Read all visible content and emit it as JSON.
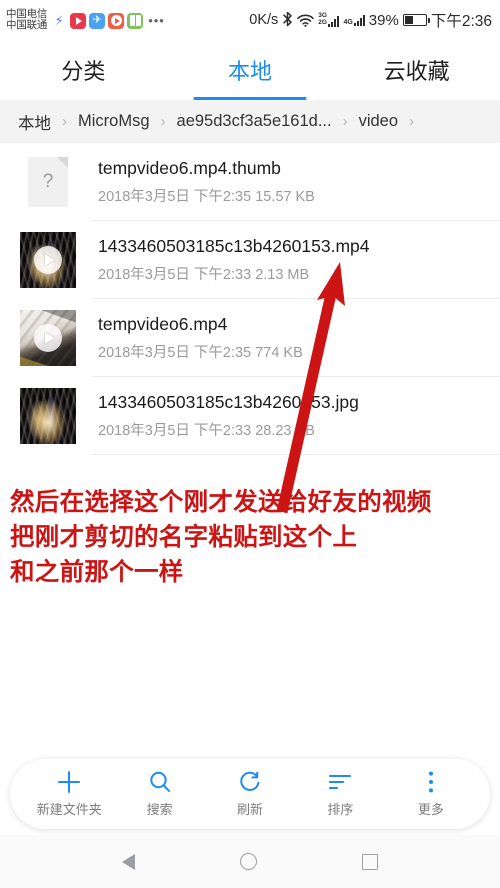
{
  "status_bar": {
    "carrier_line1": "中国电信",
    "carrier_line2": "中国联通",
    "notification_icons": [
      "bolt-icon",
      "video-app-icon",
      "telegram-icon",
      "player-app-icon",
      "notes-app-icon"
    ],
    "overflow_icon": "ellipsis-icon",
    "network_speed": "0K/s",
    "bluetooth_icon": "bluetooth-icon",
    "wifi_icon": "wifi-icon",
    "signal_label_top": "3G",
    "signal_label_bottom": "2G",
    "signal2_label": "4G",
    "battery_percent": "39%",
    "clock": "下午2:36"
  },
  "tabs": [
    {
      "label": "分类",
      "active": false
    },
    {
      "label": "本地",
      "active": true
    },
    {
      "label": "云收藏",
      "active": false
    }
  ],
  "breadcrumb": {
    "separator": "›",
    "items": [
      "本地",
      "MicroMsg",
      "ae95d3cf3a5e161d...",
      "video"
    ],
    "trailing_separator": "›"
  },
  "files": [
    {
      "name": "tempvideo6.mp4.thumb",
      "date": "2018年3月5日",
      "time": "下午2:35",
      "size": "15.57 KB",
      "thumb_type": "unknown-document",
      "thumb_glyph": "?",
      "has_play": false
    },
    {
      "name": "1433460503185c13b4260153.mp4",
      "date": "2018年3月5日",
      "time": "下午2:33",
      "size": "2.13 MB",
      "thumb_type": "fireworks",
      "thumb_glyph": "",
      "has_play": true
    },
    {
      "name": "tempvideo6.mp4",
      "date": "2018年3月5日",
      "time": "下午2:35",
      "size": "774 KB",
      "thumb_type": "room",
      "thumb_glyph": "",
      "has_play": true
    },
    {
      "name": "1433460503185c13b4260153.jpg",
      "date": "2018年3月5日",
      "time": "下午2:33",
      "size": "28.23 KB",
      "thumb_type": "fireworks",
      "thumb_glyph": "",
      "has_play": false
    }
  ],
  "annotation": {
    "color": "#cc1414",
    "line1": "然后在选择这个刚才发送给好友的视频",
    "line2": "把刚才剪切的名字粘贴到这个上",
    "line3": "和之前那个一样",
    "arrow": "red-up-arrow"
  },
  "toolbar": [
    {
      "label": "新建文件夹",
      "icon": "plus-icon"
    },
    {
      "label": "搜索",
      "icon": "search-icon"
    },
    {
      "label": "刷新",
      "icon": "refresh-icon"
    },
    {
      "label": "排序",
      "icon": "sort-icon"
    },
    {
      "label": "更多",
      "icon": "more-vertical-icon"
    }
  ],
  "nav_bar": {
    "back": "back-triangle-icon",
    "home": "home-circle-icon",
    "recents": "recents-square-icon"
  },
  "colors": {
    "accent": "#1b8cf2",
    "annotation_red": "#cc1414",
    "breadcrumb_bg": "#f3f3f3",
    "subtext": "#9b9b9b"
  }
}
